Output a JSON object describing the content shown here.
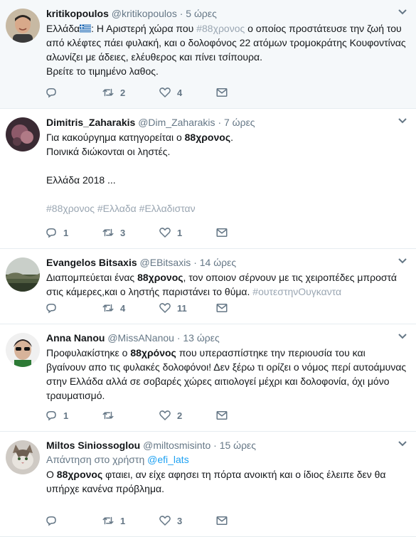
{
  "tweets": [
    {
      "name": "kritikopoulos",
      "handle": "@kritikopoulos",
      "time": "5 ώρες",
      "highlighted": true,
      "text_parts": [
        {
          "t": "Ελλάδα"
        },
        {
          "flag": "greek-flag"
        },
        {
          "t": ": Η Αριστερή χώρα που "
        },
        {
          "t": "#88χρονος",
          "cls": "tag"
        },
        {
          "t": " ο οποίος προστάτευσε την ζωή του από κλέφτες πάει φυλακή, και ο δολοφόνος 22 ατόμων τρομοκράτης Κουφοντίνας αλωνίζει με άδειες, ελέυθερος και πίνει τσίπουρα.\nΒρείτε το τιμημένο λαθος."
        }
      ],
      "counts": {
        "reply": "",
        "retweet": "2",
        "like": "4"
      },
      "avatar": "avatar-kritikopoulos"
    },
    {
      "name": "Dimitris_Zaharakis",
      "handle": "@Dim_Zaharakis",
      "time": "7 ώρες",
      "text_parts": [
        {
          "t": "Για κακούργημα κατηγορείται ο "
        },
        {
          "t": "88χρονος",
          "cls": "b"
        },
        {
          "t": ".\nΠοινικά διώκονται οι ληστές.\n\nΕλλάδα 2018 ...\n\n"
        },
        {
          "t": "#88χρονος #Ελλαδα #Ελλαδισταν",
          "cls": "tag"
        }
      ],
      "counts": {
        "reply": "1",
        "retweet": "3",
        "like": "1"
      },
      "avatar": "avatar-dimitris"
    },
    {
      "name": "Evangelos Bitsaxis",
      "handle": "@EBitsaxis",
      "time": "14 ώρες",
      "text_parts": [
        {
          "t": "Διαπομπεύεται ένας "
        },
        {
          "t": "88χρονος",
          "cls": "b"
        },
        {
          "t": ", τον οποιον σέρνουν με τις χειροπέδες μπροστά στις κάμερες,και ο ληστής παριστάνει το θύμα. "
        },
        {
          "t": "#ουτεστηνΟυγκαντα",
          "cls": "tag"
        }
      ],
      "counts": {
        "reply": "",
        "retweet": "4",
        "like": "11"
      },
      "avatar": "avatar-evangelos"
    },
    {
      "name": "Anna Nanou",
      "handle": "@MissANanou",
      "time": "13 ώρες",
      "text_parts": [
        {
          "t": "Προφυλακίστηκε ο "
        },
        {
          "t": "88χρόνος",
          "cls": "b"
        },
        {
          "t": " που υπερασπίστηκε την περιουσία του και βγαίνουν απο τις φυλακές δολοφόνοι! Δεν ξέρω τι ορίζει ο νόμος περί αυτοάμυνας στην Ελλάδα αλλά σε σοβαρές χώρες αιτιολογεί μέχρι και δολοφονία, όχι μόνο τραυματισμό."
        }
      ],
      "counts": {
        "reply": "1",
        "retweet": "",
        "like": "2"
      },
      "avatar": "avatar-anna"
    },
    {
      "name": "Miltos Siniossoglou",
      "handle": "@miltosmisinto",
      "time": "15 ώρες",
      "reply_to_label": "Απάντηση στο χρήστη",
      "reply_to_handle": "@efi_lats",
      "text_parts": [
        {
          "t": "Ο "
        },
        {
          "t": "88χρονος",
          "cls": "b"
        },
        {
          "t": " φταιει, αν είχε αφησει τη πόρτα ανοικτή και ο ίδιος έλειπε δεν θα υπήρχε κανένα πρόβλημα."
        }
      ],
      "counts": {
        "reply": "",
        "retweet": "1",
        "like": "3"
      },
      "avatar": "avatar-miltos"
    }
  ],
  "colors": {
    "meta": "#657786",
    "hashtag": "#9aa6b2",
    "link": "#1da1f2",
    "highlight_bg": "#f5f8fa",
    "divider": "#e6ecf0"
  }
}
